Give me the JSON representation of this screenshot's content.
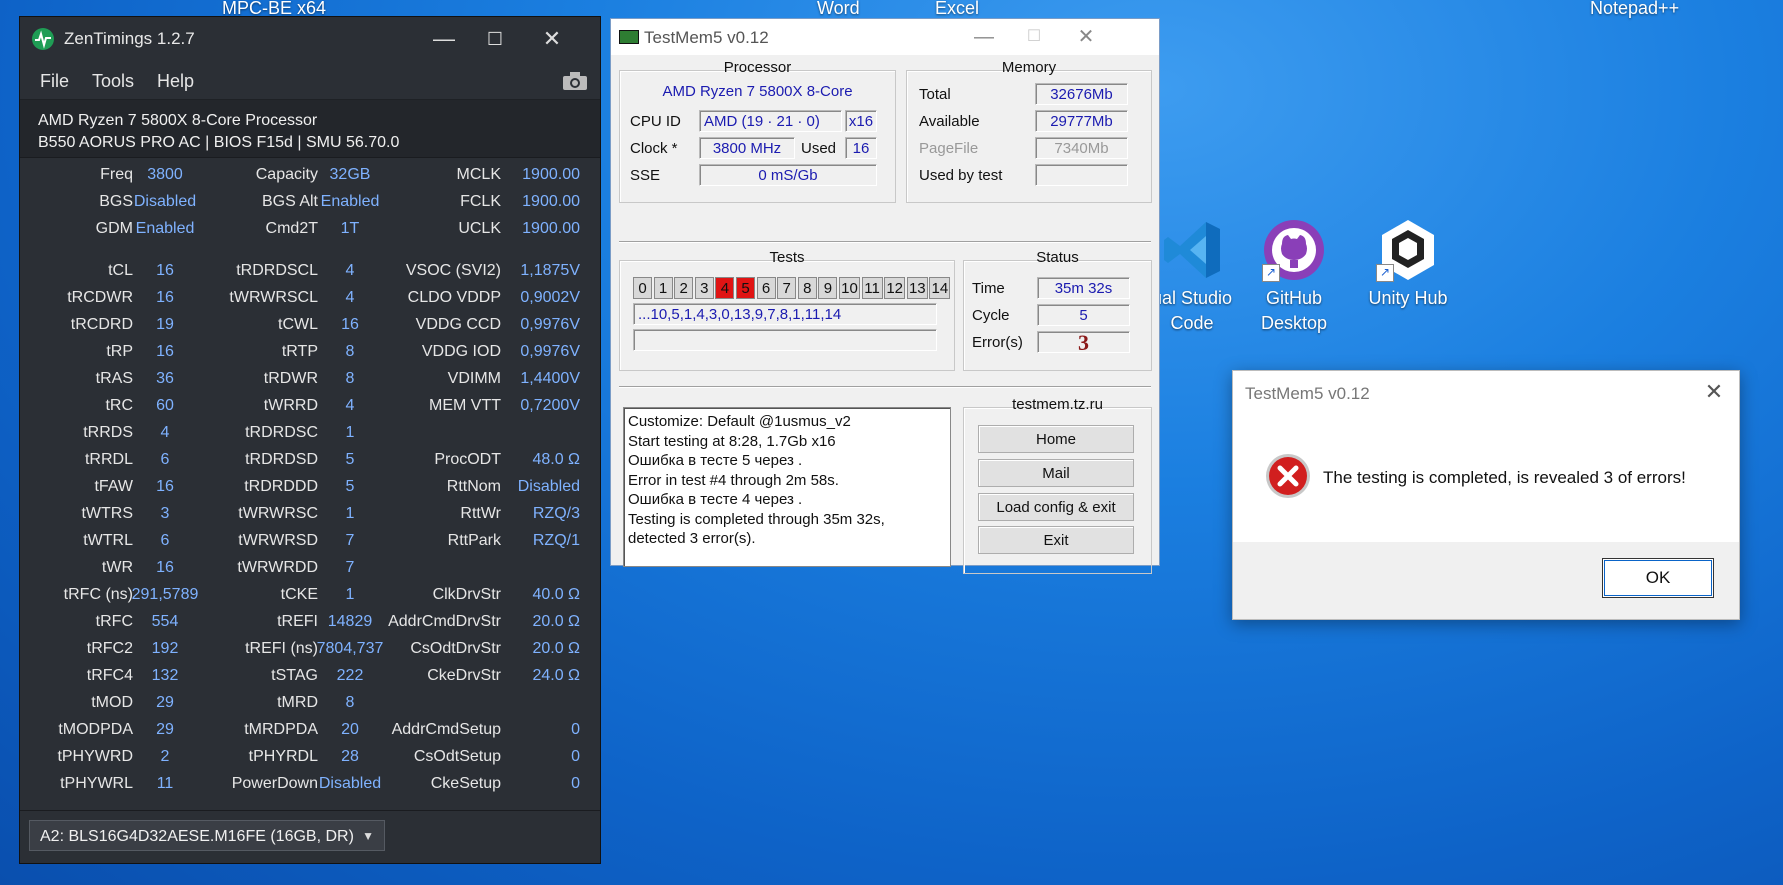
{
  "desktop": {
    "top_labels": [
      "MPC-BE x64",
      "Word",
      "Excel",
      "Notepad++"
    ],
    "icons": [
      {
        "label_line1": "ual Studio",
        "label_line2": "Code"
      },
      {
        "label_line1": "GitHub",
        "label_line2": "Desktop"
      },
      {
        "label_line1": "Unity Hub",
        "label_line2": ""
      }
    ]
  },
  "zentimings": {
    "title": "ZenTimings 1.2.7",
    "menu": [
      "File",
      "Tools",
      "Help"
    ],
    "cpu": "AMD Ryzen 7 5800X 8-Core Processor",
    "board": "B550 AORUS PRO AC | BIOS F15d | SMU 56.70.0",
    "rows": [
      [
        "Freq",
        "3800",
        "Capacity",
        "32GB",
        "MCLK",
        "1900.00"
      ],
      [
        "BGS",
        "Disabled",
        "BGS Alt",
        "Enabled",
        "FCLK",
        "1900.00"
      ],
      [
        "GDM",
        "Enabled",
        "Cmd2T",
        "1T",
        "UCLK",
        "1900.00"
      ],
      [
        "tCL",
        "16",
        "tRDRDSCL",
        "4",
        "VSOC (SVI2)",
        "1,1875V"
      ],
      [
        "tRCDWR",
        "16",
        "tWRWRSCL",
        "4",
        "CLDO VDDP",
        "0,9002V"
      ],
      [
        "tRCDRD",
        "19",
        "tCWL",
        "16",
        "VDDG CCD",
        "0,9976V"
      ],
      [
        "tRP",
        "16",
        "tRTP",
        "8",
        "VDDG IOD",
        "0,9976V"
      ],
      [
        "tRAS",
        "36",
        "tRDWR",
        "8",
        "VDIMM",
        "1,4400V"
      ],
      [
        "tRC",
        "60",
        "tWRRD",
        "4",
        "MEM VTT",
        "0,7200V"
      ],
      [
        "tRRDS",
        "4",
        "tRDRDSC",
        "1",
        "",
        ""
      ],
      [
        "tRRDL",
        "6",
        "tRDRDSD",
        "5",
        "ProcODT",
        "48.0 Ω"
      ],
      [
        "tFAW",
        "16",
        "tRDRDDD",
        "5",
        "RttNom",
        "Disabled"
      ],
      [
        "tWTRS",
        "3",
        "tWRWRSC",
        "1",
        "RttWr",
        "RZQ/3"
      ],
      [
        "tWTRL",
        "6",
        "tWRWRSD",
        "7",
        "RttPark",
        "RZQ/1"
      ],
      [
        "tWR",
        "16",
        "tWRWRDD",
        "7",
        "",
        ""
      ],
      [
        "tRFC (ns)",
        "291,5789",
        "tCKE",
        "1",
        "ClkDrvStr",
        "40.0 Ω"
      ],
      [
        "tRFC",
        "554",
        "tREFI",
        "14829",
        "AddrCmdDrvStr",
        "20.0 Ω"
      ],
      [
        "tRFC2",
        "192",
        "tREFI (ns)",
        "7804,737",
        "CsOdtDrvStr",
        "20.0 Ω"
      ],
      [
        "tRFC4",
        "132",
        "tSTAG",
        "222",
        "CkeDrvStr",
        "24.0 Ω"
      ],
      [
        "tMOD",
        "29",
        "tMRD",
        "8",
        "",
        ""
      ],
      [
        "tMODPDA",
        "29",
        "tMRDPDA",
        "20",
        "AddrCmdSetup",
        "0"
      ],
      [
        "tPHYWRD",
        "2",
        "tPHYRDL",
        "28",
        "CsOdtSetup",
        "0"
      ],
      [
        "tPHYWRL",
        "11",
        "PowerDown",
        "Disabled",
        "CkeSetup",
        "0"
      ]
    ],
    "dimm_selected": "A2: BLS16G4D32AESE.M16FE (16GB, DR)"
  },
  "testmem": {
    "title": "TestMem5 v0.12",
    "processor": {
      "heading": "Processor",
      "name": "AMD Ryzen 7 5800X 8-Core",
      "cpu_id_label": "CPU ID",
      "cpu_id": "AMD  (19 · 21 · 0)",
      "threads": "x16",
      "clock_label": "Clock *",
      "clock": "3800 MHz",
      "used_label": "Used",
      "used": "16",
      "sse_label": "SSE",
      "sse": "0 mS/Gb"
    },
    "memory": {
      "heading": "Memory",
      "total_label": "Total",
      "total": "32676Mb",
      "available_label": "Available",
      "available": "29777Mb",
      "pagefile_label": "PageFile",
      "pagefile": "7340Mb",
      "usedby_label": "Used by test",
      "usedby": ""
    },
    "tests": {
      "heading": "Tests",
      "boxes": [
        "0",
        "1",
        "2",
        "3",
        "4",
        "5",
        "6",
        "7",
        "8",
        "9",
        "10",
        "11",
        "12",
        "13",
        "14"
      ],
      "error_boxes": [
        "4",
        "5"
      ],
      "sequence": "...10,5,1,4,3,0,13,9,7,8,1,11,14",
      "progress": ""
    },
    "status": {
      "heading": "Status",
      "time_label": "Time",
      "time": "35m 32s",
      "cycle_label": "Cycle",
      "cycle": "5",
      "errors_label": "Error(s)",
      "errors": "3"
    },
    "log": [
      "Customize: Default @1usmus_v2",
      "Start testing at 8:28, 1.7Gb x16",
      "Ошибка в тесте 5 через .",
      "Error in test #4 through 2m 58s.",
      "Ошибка в тесте 4 через .",
      "Testing is completed through 35m 32s,",
      "detected 3 error(s)."
    ],
    "links": {
      "heading": "testmem.tz.ru",
      "home": "Home",
      "mail": "Mail",
      "load": "Load config & exit",
      "exit": "Exit"
    }
  },
  "dialog": {
    "title": "TestMem5 v0.12",
    "message": "The testing is completed, is revealed 3 of errors!",
    "ok": "OK"
  },
  "colors": {
    "zen_value": "#7fb2ff",
    "zen_bg": "#2b2f35",
    "error_red": "#e01414",
    "desktop_blue": "#1b7fe0"
  }
}
